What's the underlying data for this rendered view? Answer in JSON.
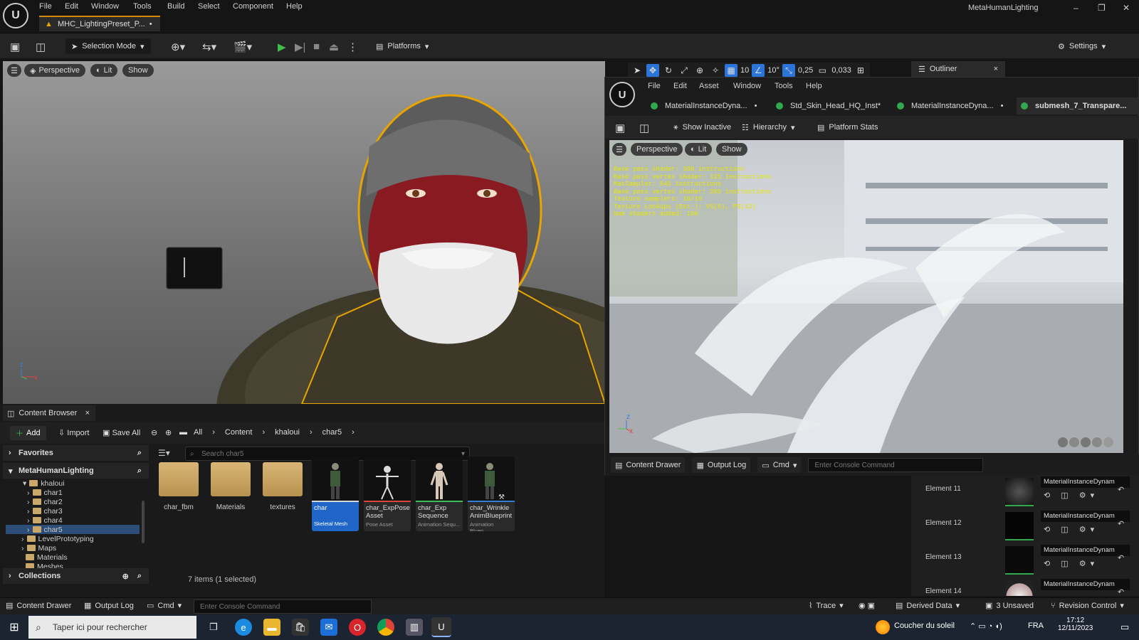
{
  "app": {
    "window_title": "MetaHumanLighting",
    "menu": [
      "File",
      "Edit",
      "Window",
      "Tools",
      "Build",
      "Select",
      "Component",
      "Help"
    ],
    "doc_tab": "MHC_LightingPreset_P...",
    "doc_tab_dirty": "•",
    "min": "–",
    "max": "❐",
    "close": "✕"
  },
  "toolbar": {
    "selection_mode": "Selection Mode",
    "platforms": "Platforms",
    "settings": "Settings"
  },
  "viewport": {
    "perspective": "Perspective",
    "lit": "Lit",
    "show": "Show",
    "grid_snap": "10",
    "rot_snap": "10°",
    "scale_snap": "0,25",
    "cam_speed": "0,033",
    "axis_z": "z",
    "axis_x": "x"
  },
  "outliner": {
    "tab": "Outliner",
    "close": "×"
  },
  "material_editor": {
    "menu": [
      "File",
      "Edit",
      "Asset",
      "Window",
      "Tools",
      "Help"
    ],
    "tabs": [
      "MaterialInstanceDyna...",
      "Std_Skin_Head_HQ_Inst*",
      "MaterialInstanceDyna...",
      "submesh_7_Transpare..."
    ],
    "tab_dirty": "•",
    "show_inactive": "Show Inactive",
    "hierarchy": "Hierarchy",
    "platform_stats": "Platform Stats",
    "perspective": "Perspective",
    "lit": "Lit",
    "show": "Show",
    "stats": [
      "Base pass shader: 380 instructions",
      "Base pass vertex shader: 125 instructions",
      "MaxSampler: 545 instructions",
      "Base pass vertex shader: 205 instructions",
      "Texture samplers: 10/16",
      "Texture Lookups (Est.): VS(6), PS(13)",
      "Num shaders added: 180"
    ],
    "content_drawer": "Content Drawer",
    "output_log": "Output Log",
    "cmd": "Cmd",
    "console_placeholder": "Enter Console Command",
    "axis_z": "z",
    "axis_x": "x"
  },
  "elements": [
    {
      "name": "Element 11",
      "instance": "MaterialInstanceDynam"
    },
    {
      "name": "Element 12",
      "instance": "MaterialInstanceDynam"
    },
    {
      "name": "Element 13",
      "instance": "MaterialInstanceDynam"
    },
    {
      "name": "Element 14",
      "instance": "MaterialInstanceDynam"
    }
  ],
  "content_browser": {
    "tab": "Content Browser",
    "add": "Add",
    "import": "Import",
    "save_all": "Save All",
    "breadcrumb": [
      "All",
      "Content",
      "khaloui",
      "char5"
    ],
    "favorites": "Favorites",
    "root": "MetaHumanLighting",
    "tree": [
      "khaloui",
      "char1",
      "char2",
      "char3",
      "char4",
      "char5",
      "LevelPrototyping",
      "Maps",
      "Materials",
      "Meshes"
    ],
    "collections": "Collections",
    "search_placeholder": "Search char5",
    "folders": [
      "char_fbm",
      "Materials",
      "textures"
    ],
    "assets": [
      {
        "name": "char",
        "type": "Skeletal Mesh",
        "bar": "#d8d8d8"
      },
      {
        "name": "char_ExpPose Asset",
        "type": "Pose Asset",
        "bar": "#d9443b"
      },
      {
        "name": "char_Exp Sequence",
        "type": "Animation Sequ...",
        "bar": "#3bbf5a"
      },
      {
        "name": "char_Wrinkle AnimBlueprint",
        "type": "Animation Bluep...",
        "bar": "#2f7fd6"
      }
    ],
    "status": "7 items (1 selected)"
  },
  "statusbar": {
    "content_drawer": "Content Drawer",
    "output_log": "Output Log",
    "cmd": "Cmd",
    "console_placeholder": "Enter Console Command",
    "trace": "Trace",
    "derived_data": "Derived Data",
    "unsaved": "3 Unsaved",
    "revision_control": "Revision Control"
  },
  "taskbar": {
    "search": "Taper ici pour rechercher",
    "weather": "Coucher du soleil",
    "lang": "FRA",
    "time": "17:12",
    "date": "12/11/2023"
  },
  "colors": {
    "accent": "#2b74d9",
    "selection_orange": "#e8a400",
    "face": "#8a1a22",
    "stats_text": "#e6e600"
  }
}
